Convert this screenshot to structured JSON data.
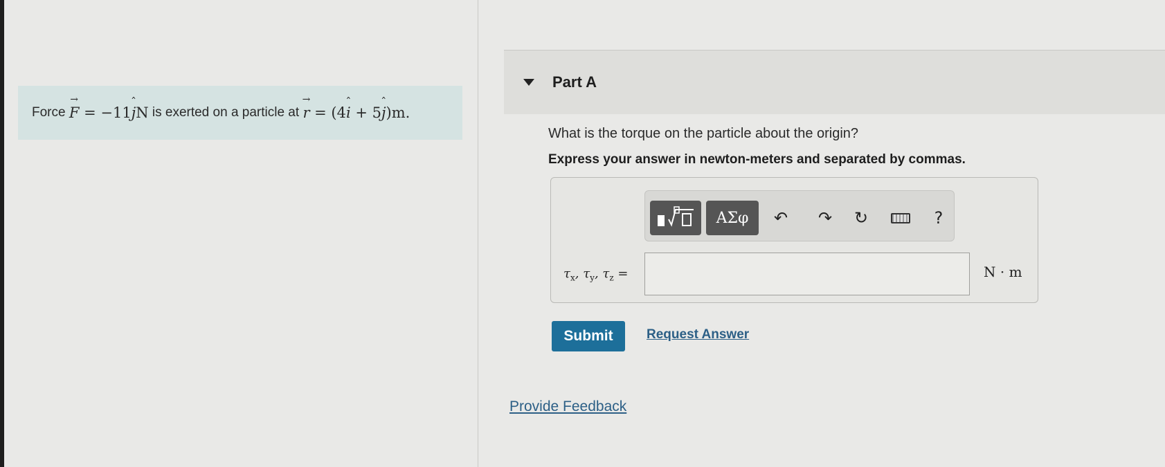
{
  "problem": {
    "prefix": "Force",
    "force_symbol": "F",
    "force_value": " = −11",
    "j_unit": "j",
    "force_unit": "N",
    "middle": " is exerted on a particle at ",
    "position_symbol": "r",
    "position_value": " = (4",
    "i_unit": "i",
    "plus_five": " + 5",
    "j_unit_2": "j",
    "position_unit": ")m."
  },
  "part": {
    "title": "Part A"
  },
  "question": {
    "text": "What is the torque on the particle about the origin?",
    "instruction": "Express your answer in newton-meters and separated by commas."
  },
  "toolbar": {
    "template_label": "▮√▯",
    "greek_label": "ΑΣφ",
    "undo_label": "↶",
    "redo_label": "↷",
    "reset_label": "↻",
    "help_label": "?"
  },
  "answer": {
    "tau": "τ",
    "sub_x": "x",
    "sub_y": "y",
    "sub_z": "z",
    "separator": ", ",
    "equals": " =",
    "value": "",
    "unit": "N · m"
  },
  "actions": {
    "submit_label": "Submit",
    "request_label": "Request Answer",
    "feedback_label": "Provide Feedback"
  },
  "colors": {
    "problem_bg": "#d5e3e2",
    "submit_bg": "#1d6f9a",
    "link": "#2c5f86"
  }
}
